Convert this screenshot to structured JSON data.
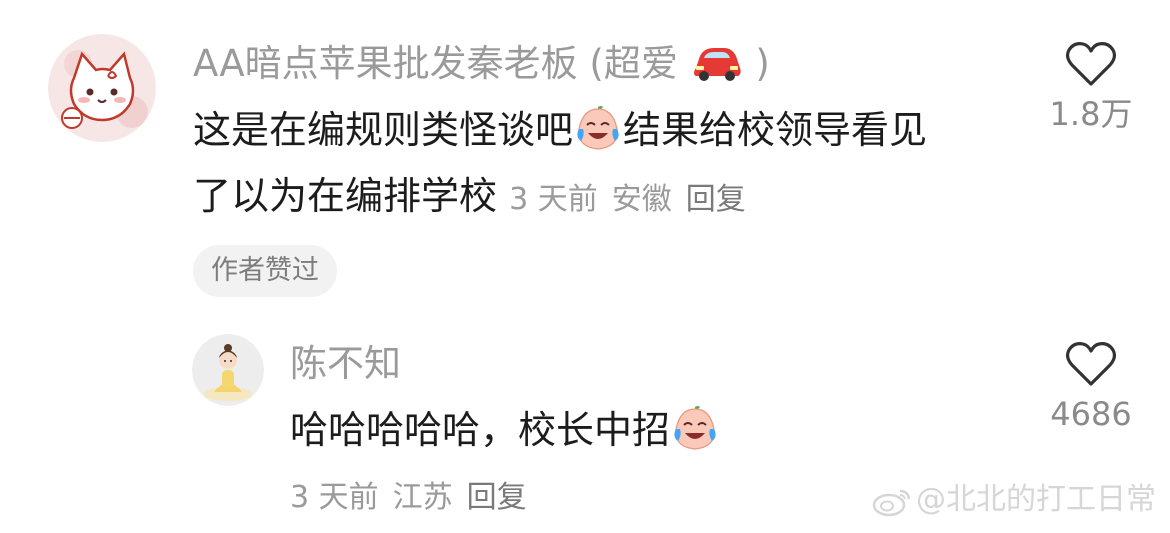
{
  "comment": {
    "username": "AA暗点苹果批发秦老板 (超爱",
    "username_end": ")",
    "text_part1": "这是在编规则类怪谈吧",
    "text_part2": "结果给校领导看见",
    "text_line2": "了以为在编排学校",
    "time": "3 天前",
    "location": "安徽",
    "reply_label": "回复",
    "badge": "作者赞过",
    "like_count": "1.8万",
    "avatar_icon": "cat-avatar-icon",
    "username_emoji": "red-car-emoji",
    "text_emoji": "laughing-tears-emoji"
  },
  "reply": {
    "username": "陈不知",
    "text": "哈哈哈哈哈，校长中招",
    "time": "3 天前",
    "location": "江苏",
    "reply_label": "回复",
    "like_count": "4686",
    "avatar_icon": "meditating-figure-avatar-icon",
    "text_emoji": "laughing-tears-emoji"
  },
  "watermark": {
    "text": "@北北的打工日常",
    "icon": "weibo-logo-icon"
  },
  "colors": {
    "text_primary": "#1c1c1c",
    "text_secondary": "#9a9a9a",
    "badge_bg": "#f2f2f2"
  }
}
